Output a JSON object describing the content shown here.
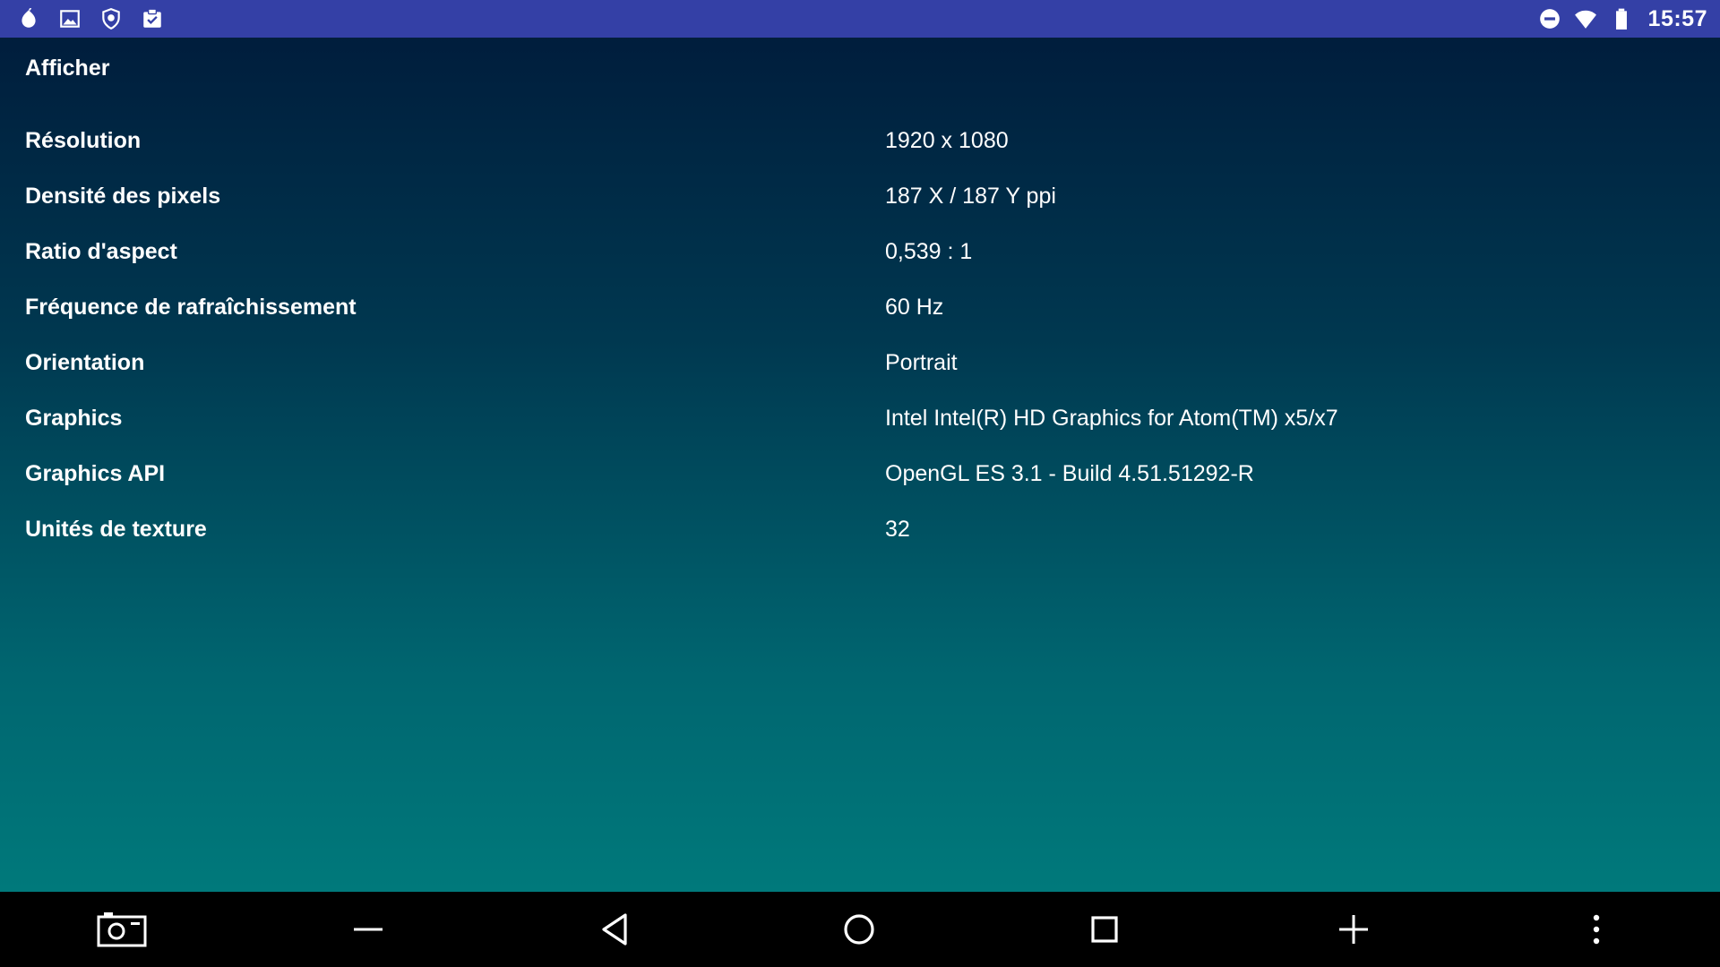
{
  "status_bar": {
    "background": "#3440a6",
    "left_icons": [
      "app-drop-icon",
      "image-icon",
      "shield-icon",
      "clipboard-check-icon"
    ],
    "right_icons": [
      "do-not-disturb-icon",
      "wifi-icon",
      "battery-icon"
    ],
    "time": "15:57"
  },
  "section": {
    "title": "Afficher"
  },
  "rows": [
    {
      "label": "Résolution",
      "value": "1920 x 1080"
    },
    {
      "label": "Densité des pixels",
      "value": "187 X / 187 Y ppi"
    },
    {
      "label": "Ratio d'aspect",
      "value": "0,539 : 1"
    },
    {
      "label": "Fréquence de rafraîchissement",
      "value": "60 Hz"
    },
    {
      "label": "Orientation",
      "value": "Portrait"
    },
    {
      "label": "Graphics",
      "value": "Intel Intel(R) HD Graphics for Atom(TM) x5/x7"
    },
    {
      "label": "Graphics API",
      "value": "OpenGL ES 3.1 - Build 4.51.51292-R"
    },
    {
      "label": "Unités de texture",
      "value": "32"
    }
  ],
  "nav_bar": {
    "buttons": [
      "screenshot-icon",
      "volume-down-icon",
      "back-icon",
      "home-icon",
      "recents-icon",
      "volume-up-icon",
      "more-icon"
    ]
  }
}
